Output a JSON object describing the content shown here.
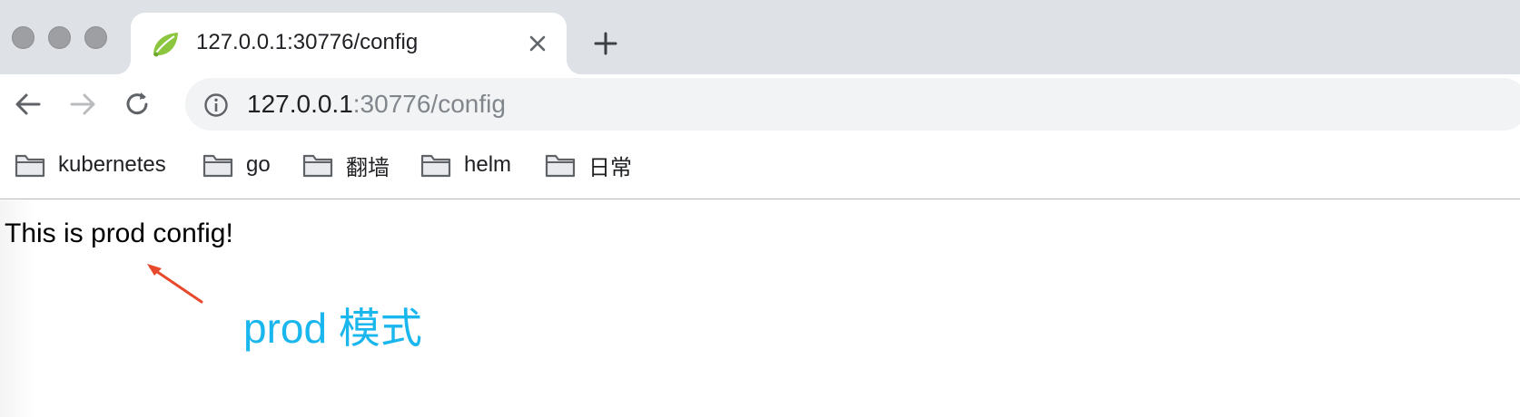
{
  "window": {
    "controls": [
      "close",
      "minimize",
      "maximize"
    ]
  },
  "tab": {
    "title": "127.0.0.1:30776/config",
    "favicon": "spring-leaf-icon"
  },
  "toolbar": {
    "url_host": "127.0.0.1",
    "url_rest": ":30776/config",
    "icons": [
      "back-arrow-icon",
      "forward-arrow-icon",
      "reload-icon",
      "info-icon"
    ]
  },
  "bookmarks": [
    {
      "label": "kubernetes",
      "icon": "folder-icon"
    },
    {
      "label": "go",
      "icon": "folder-icon"
    },
    {
      "label": "翻墙",
      "icon": "folder-icon"
    },
    {
      "label": "helm",
      "icon": "folder-icon"
    },
    {
      "label": "日常",
      "icon": "folder-icon"
    }
  ],
  "page": {
    "body_text": "This is prod config!"
  },
  "annotation": {
    "text": "prod 模式",
    "color": "#1ab6ee",
    "arrow_color": "#e8482b"
  }
}
